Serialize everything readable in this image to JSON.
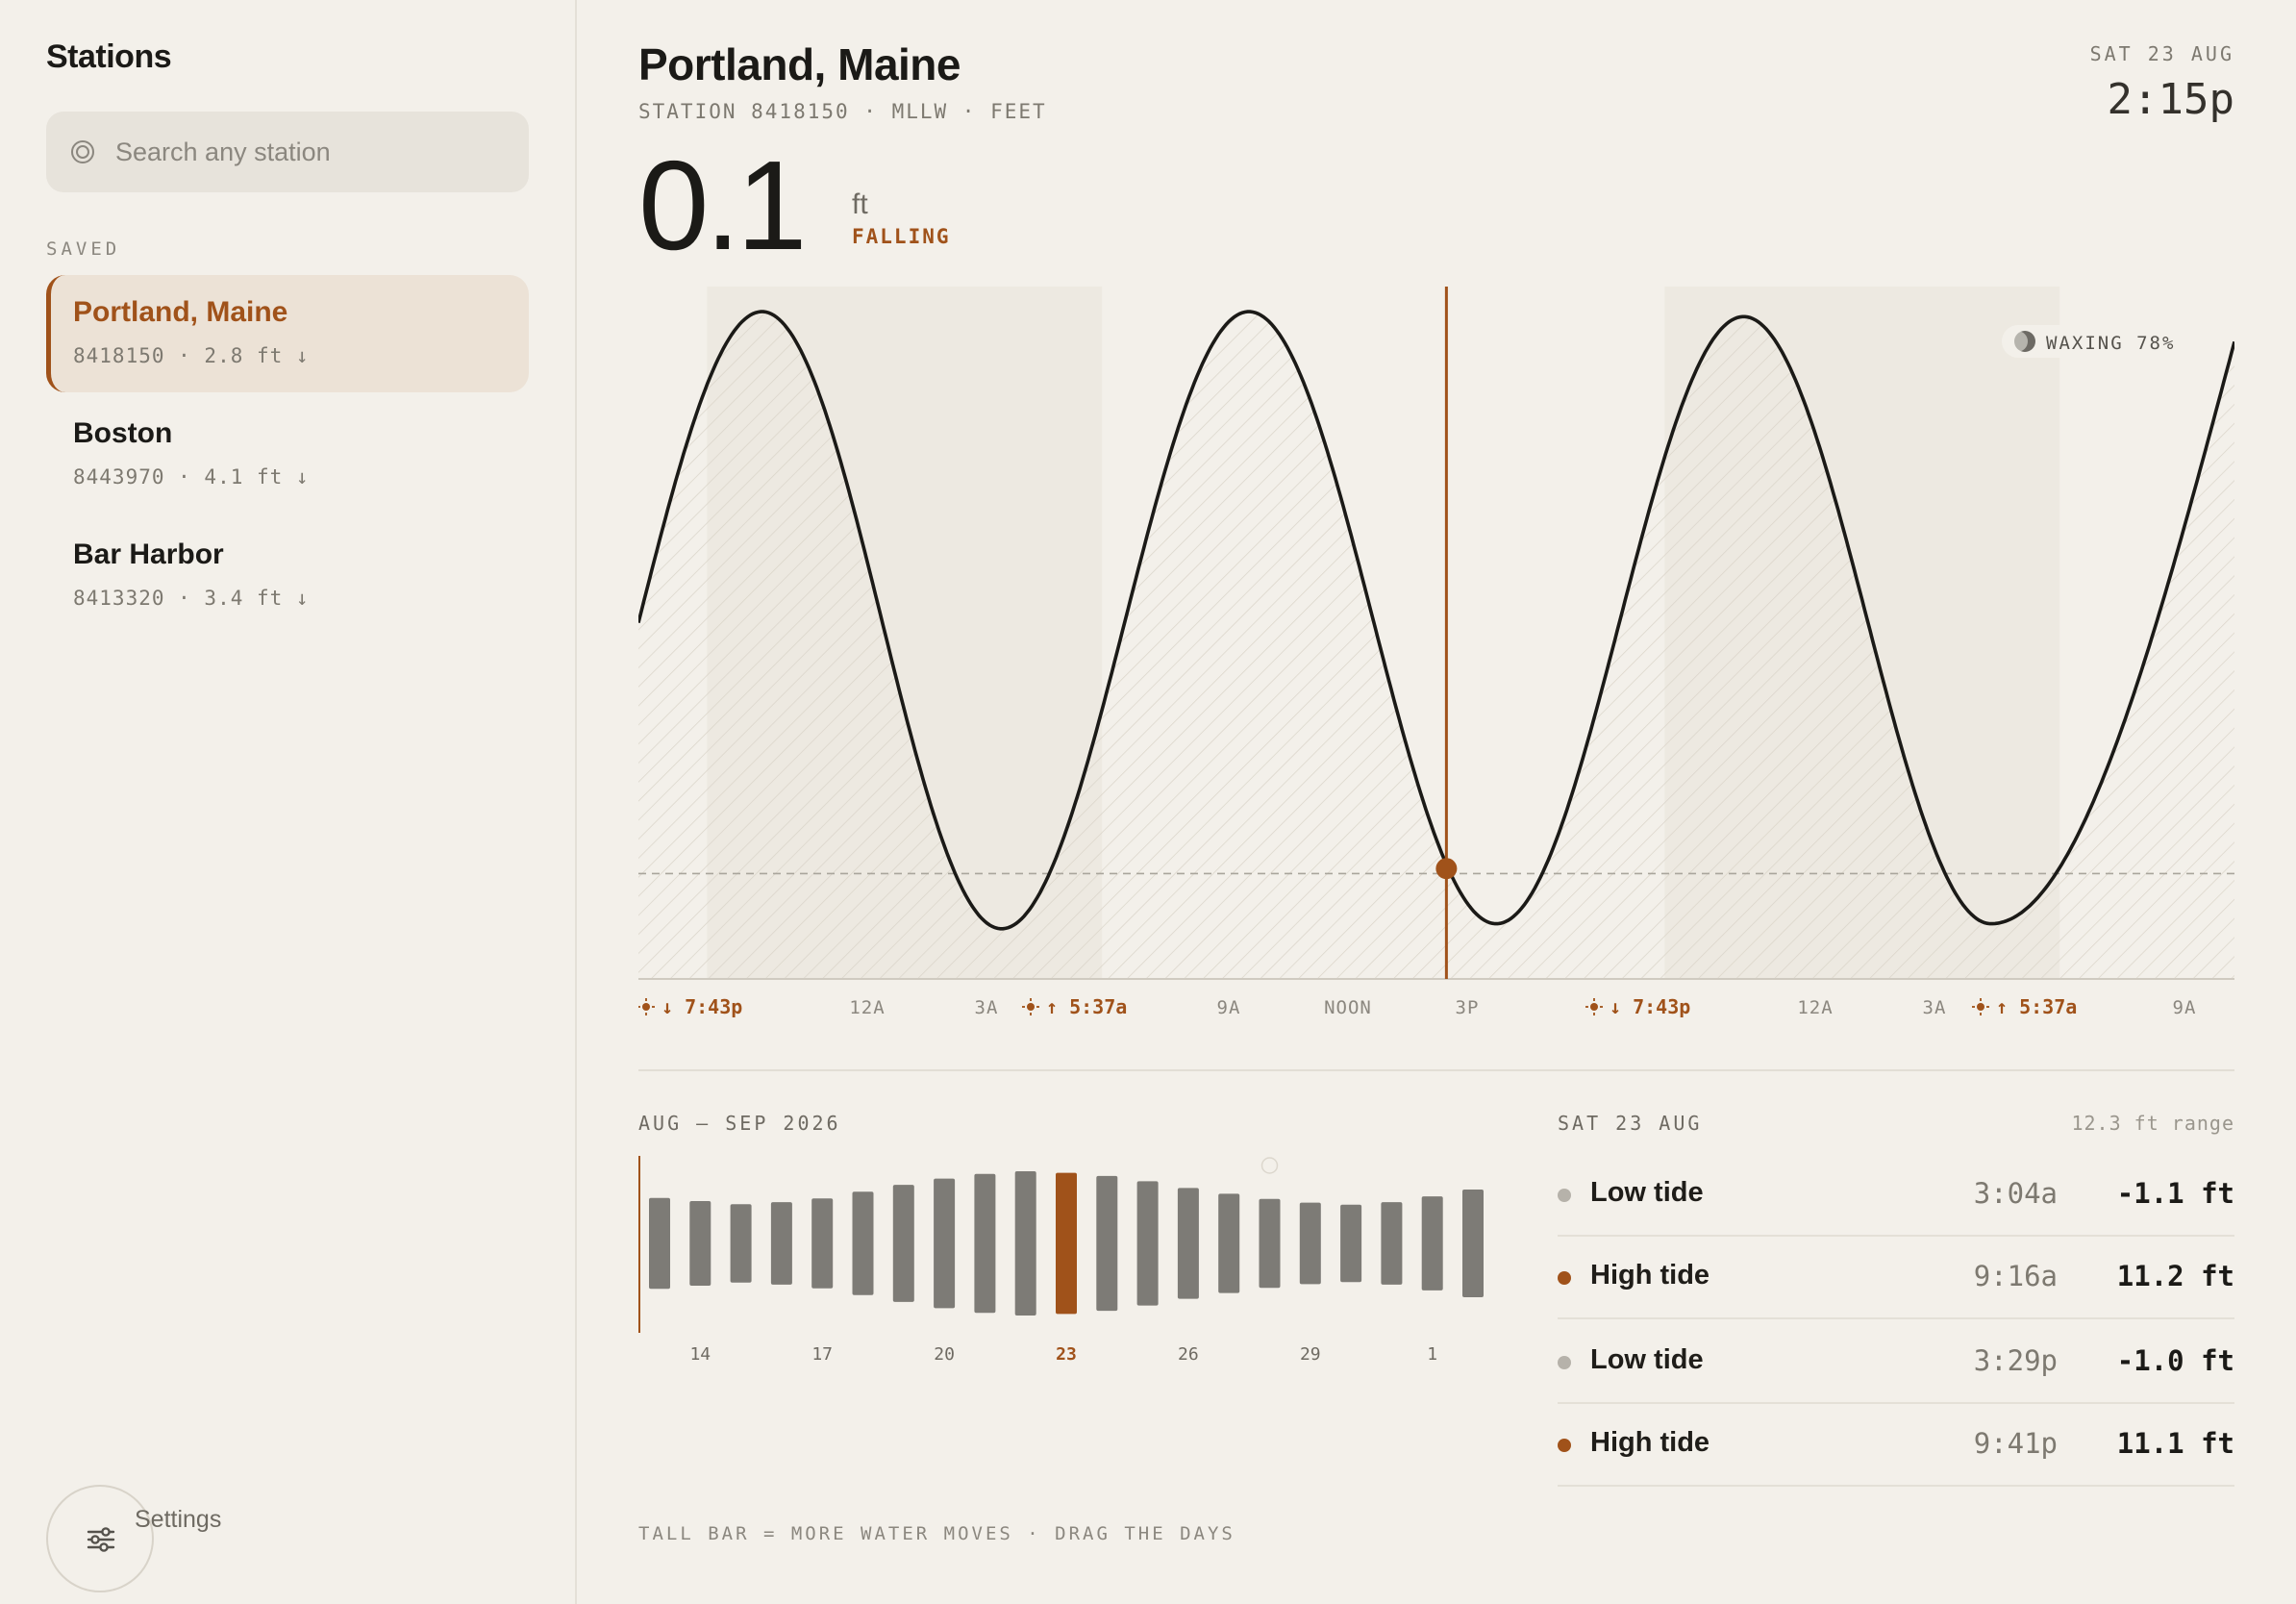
{
  "sidebar": {
    "title": "Stations",
    "search_placeholder": "Search any station",
    "saved_label": "SAVED",
    "stations": [
      {
        "name": "Portland, Maine",
        "meta": "8418150 · 2.8 ft ↓",
        "active": true
      },
      {
        "name": "Boston",
        "meta": "8443970 · 4.1 ft ↓",
        "active": false
      },
      {
        "name": "Bar Harbor",
        "meta": "8413320 · 3.4 ft ↓",
        "active": false
      }
    ],
    "settings_label": "Settings"
  },
  "header": {
    "title": "Portland, Maine",
    "subtitle": "STATION 8418150 · MLLW · FEET",
    "date": "SAT 23 AUG",
    "time": "2:15p"
  },
  "current": {
    "value": "0.1",
    "unit": "ft",
    "trend": "FALLING"
  },
  "moon": {
    "label": "WAXING 78%",
    "icon": "moon-icon"
  },
  "chart_data": [
    {
      "type": "line",
      "xlabel": "",
      "ylabel": "",
      "x_ticks": [
        {
          "label": "7:43p",
          "kind": "sunset",
          "marker": "↓"
        },
        {
          "label": "12A",
          "kind": "time"
        },
        {
          "label": "3A",
          "kind": "time"
        },
        {
          "label": "5:37a",
          "kind": "sunrise",
          "marker": "↑"
        },
        {
          "label": "9A",
          "kind": "time"
        },
        {
          "label": "NOON",
          "kind": "time"
        },
        {
          "label": "3P",
          "kind": "time"
        },
        {
          "label": "7:43p",
          "kind": "sunset",
          "marker": "↓"
        },
        {
          "label": "12A",
          "kind": "time"
        },
        {
          "label": "3A",
          "kind": "time"
        },
        {
          "label": "5:37a",
          "kind": "sunrise",
          "marker": "↑"
        },
        {
          "label": "9A",
          "kind": "time"
        }
      ],
      "x_hours_range": [
        18,
        58
      ],
      "ylim": [
        -2.1,
        11.7
      ],
      "series": [
        {
          "x": [
            18.0,
            21.1,
            27.1,
            33.3,
            39.5,
            45.7,
            51.9,
            58.0
          ],
          "y": [
            5.0,
            11.2,
            -1.1,
            11.2,
            -1.0,
            11.1,
            -1.0,
            10.6
          ]
        }
      ],
      "extremes": [
        {
          "hour": 21.1,
          "value": 11.2
        },
        {
          "hour": 27.1,
          "value": -1.1
        },
        {
          "hour": 33.3,
          "value": 11.2
        },
        {
          "hour": 39.5,
          "value": -1.0
        },
        {
          "hour": 45.7,
          "value": 11.1
        },
        {
          "hour": 51.9,
          "value": -1.0
        }
      ],
      "night_bands": [
        [
          19.72,
          29.62
        ],
        [
          43.72,
          53.62
        ]
      ],
      "datum_line_value": 0.0,
      "current_hour": 38.25,
      "current_value": 0.1
    },
    {
      "type": "bar",
      "title": "AUG — SEP 2026",
      "categories": [
        "13",
        "14",
        "15",
        "16",
        "17",
        "18",
        "19",
        "20",
        "21",
        "22",
        "23",
        "24",
        "25",
        "26",
        "27",
        "28",
        "29",
        "30",
        "31",
        "1",
        "2"
      ],
      "tick_labels": [
        "14",
        "17",
        "20",
        "23",
        "26",
        "29",
        "1"
      ],
      "values": [
        8.7,
        8.1,
        7.5,
        7.9,
        8.6,
        9.9,
        11.2,
        12.4,
        13.3,
        13.8,
        13.5,
        12.9,
        11.9,
        10.6,
        9.5,
        8.5,
        7.8,
        7.4,
        7.9,
        9.0,
        10.3
      ],
      "highlight": "23",
      "ylim": [
        0,
        14
      ]
    }
  ],
  "tide_table": {
    "date": "SAT 23 AUG",
    "range": "12.3 ft range",
    "rows": [
      {
        "type": "Low tide",
        "time": "3:04a",
        "height": "-1.1 ft",
        "kind": "low"
      },
      {
        "type": "High tide",
        "time": "9:16a",
        "height": "11.2 ft",
        "kind": "high"
      },
      {
        "type": "Low tide",
        "time": "3:29p",
        "height": "-1.0 ft",
        "kind": "low"
      },
      {
        "type": "High tide",
        "time": "9:41p",
        "height": "11.1 ft",
        "kind": "high"
      }
    ]
  },
  "footer": {
    "note": "TALL BAR = MORE WATER MOVES · DRAG THE DAYS"
  },
  "colors": {
    "accent": "#a0521a",
    "background": "#f3f0ea",
    "bar": "#7d7b76",
    "curve": "#1b1a17",
    "low_dot": "#b6b2aa"
  }
}
